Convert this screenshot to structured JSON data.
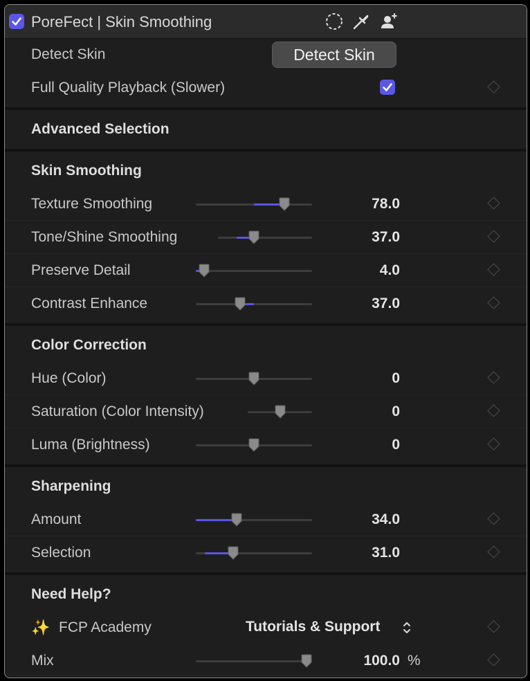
{
  "header": {
    "title": "PoreFect | Skin Smoothing",
    "enabled": true,
    "icons": [
      "ellipse-mask-icon",
      "eyedropper-icon",
      "person-add-icon"
    ]
  },
  "detect_skin": {
    "label": "Detect Skin",
    "button_label": "Detect Skin"
  },
  "full_quality": {
    "label": "Full Quality Playback (Slower)",
    "checked": true
  },
  "advanced_selection": {
    "title": "Advanced Selection"
  },
  "skin_smoothing": {
    "title": "Skin Smoothing",
    "params": [
      {
        "label": "Texture Smoothing",
        "value": "78.0",
        "fill_from": 0.5,
        "fill_to": 0.76
      },
      {
        "label": "Tone/Shine Smoothing",
        "value": "37.0",
        "fill_from": 0.2,
        "fill_to": 0.38
      },
      {
        "label": "Preserve Detail",
        "value": "4.0",
        "fill_from": 0.0,
        "fill_to": 0.07
      },
      {
        "label": "Contrast Enhance",
        "value": "37.0",
        "fill_from": 0.38,
        "fill_to": 0.5
      }
    ]
  },
  "color_correction": {
    "title": "Color Correction",
    "params": [
      {
        "label": "Hue (Color)",
        "value": "0",
        "fill_from": 0.5,
        "fill_to": 0.5
      },
      {
        "label": "Saturation (Color Intensity)",
        "value": "0",
        "fill_from": 0.5,
        "fill_to": 0.5
      },
      {
        "label": "Luma (Brightness)",
        "value": "0",
        "fill_from": 0.5,
        "fill_to": 0.5
      }
    ]
  },
  "sharpening": {
    "title": "Sharpening",
    "params": [
      {
        "label": "Amount",
        "value": "34.0",
        "fill_from": 0.0,
        "fill_to": 0.35
      },
      {
        "label": "Selection",
        "value": "31.0",
        "fill_from": 0.08,
        "fill_to": 0.32
      }
    ]
  },
  "help": {
    "title": "Need Help?",
    "academy_label": "FCP Academy",
    "academy_icon": "sparkles-icon",
    "popup_value": "Tutorials & Support"
  },
  "mix": {
    "label": "Mix",
    "value": "100.0",
    "unit": "%",
    "fill_from": 0.95,
    "fill_to": 0.95
  },
  "colors": {
    "accent": "#5b57e6",
    "panel": "#1e1e1e",
    "header": "#2b2b2b"
  }
}
